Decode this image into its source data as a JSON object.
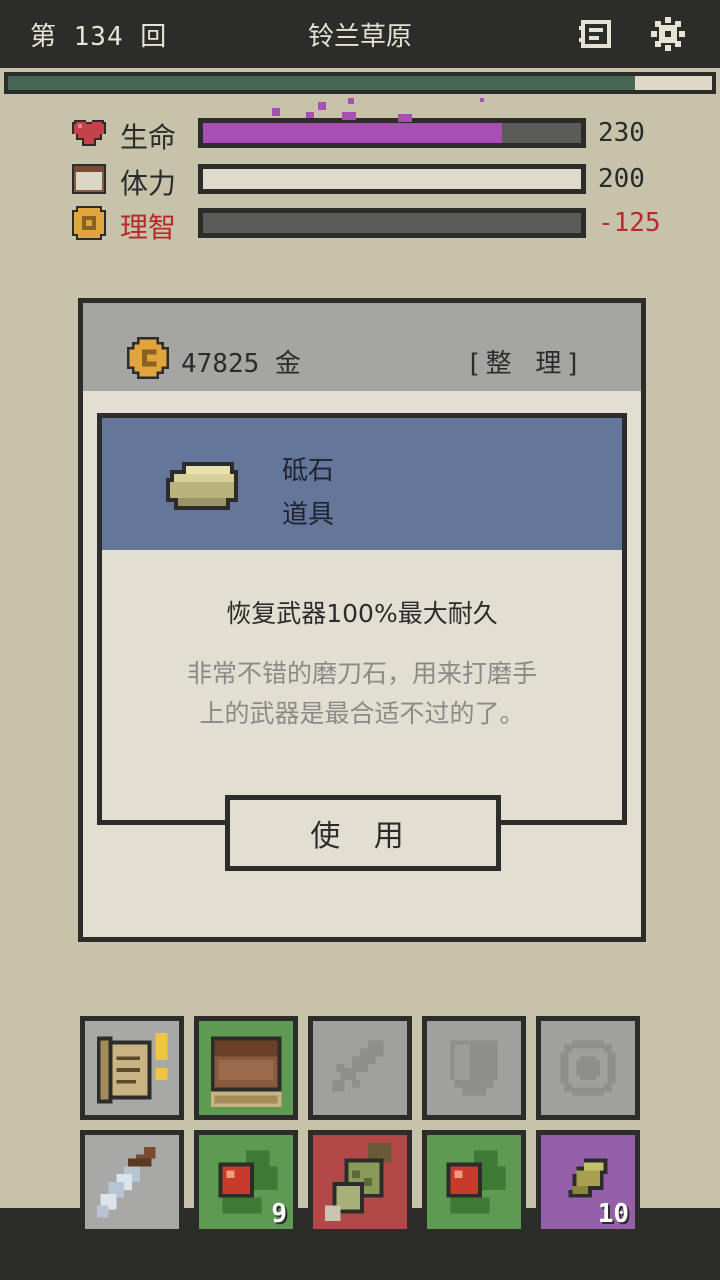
{
  "top_bar": {
    "round": "第 134 回",
    "location": "铃兰草原",
    "icons": [
      "journal-icon",
      "gear-icon"
    ]
  },
  "progress": {
    "fraction": 0.89
  },
  "stats": [
    {
      "label": "生命",
      "value": "230",
      "fill_fraction": 0.79,
      "fill_color": "#a84fb4",
      "icon": "heart-icon",
      "value_color": "#2b2b2b",
      "label_color": "#2b2b2b"
    },
    {
      "label": "体力",
      "value": "200",
      "fill_fraction": 1.0,
      "fill_color": "#dedbcc",
      "icon": "bread-icon",
      "value_color": "#2b2b2b",
      "label_color": "#2b2b2b"
    },
    {
      "label": "理智",
      "value": "-125",
      "fill_fraction": 0.0,
      "fill_color": "#5b5b5a",
      "icon": "sanity-icon",
      "value_color": "#b52a2a",
      "label_color": "#b52a2a"
    }
  ],
  "panel": {
    "gold": "47825 金",
    "sort_label": "[整 理]",
    "item": {
      "name": "砥石",
      "type": "道具",
      "effect": "恢复武器100%最大耐久",
      "description_lines": [
        "非常不错的磨刀石，用来打磨手",
        "上的武器是最合适不过的了。"
      ],
      "icon": "whetstone-icon"
    },
    "use_label": "使 用"
  },
  "equipment_slots": [
    {
      "name": "quest-scroll-slot",
      "icon": "scroll-icon",
      "bg": "#a8a8a6",
      "active": true,
      "alert": true
    },
    {
      "name": "backpack-slot",
      "icon": "backpack-icon",
      "bg": "#5f9a52",
      "active": true,
      "alert": false
    },
    {
      "name": "weapon-slot",
      "icon": "sword-icon",
      "bg": "#a0a09e",
      "active": false,
      "alert": false
    },
    {
      "name": "armor-slot",
      "icon": "shield-icon",
      "bg": "#a0a09e",
      "active": false,
      "alert": false
    },
    {
      "name": "accessory-slot",
      "icon": "ring-icon",
      "bg": "#a0a09e",
      "active": false,
      "alert": false
    }
  ],
  "inventory_slots": [
    {
      "name": "dagger-slot",
      "icon": "dagger-icon",
      "bg": "#a8a8a6",
      "count": ""
    },
    {
      "name": "berry-slot-1",
      "icon": "berry-icon",
      "bg": "#5f9a52",
      "count": "9"
    },
    {
      "name": "scroll-map-slot",
      "icon": "map-icon",
      "bg": "#b24848",
      "count": ""
    },
    {
      "name": "berry-slot-2",
      "icon": "berry-icon",
      "bg": "#5f9a52",
      "count": ""
    },
    {
      "name": "seed-slot",
      "icon": "seed-icon",
      "bg": "#9560aa",
      "count": "10"
    }
  ]
}
